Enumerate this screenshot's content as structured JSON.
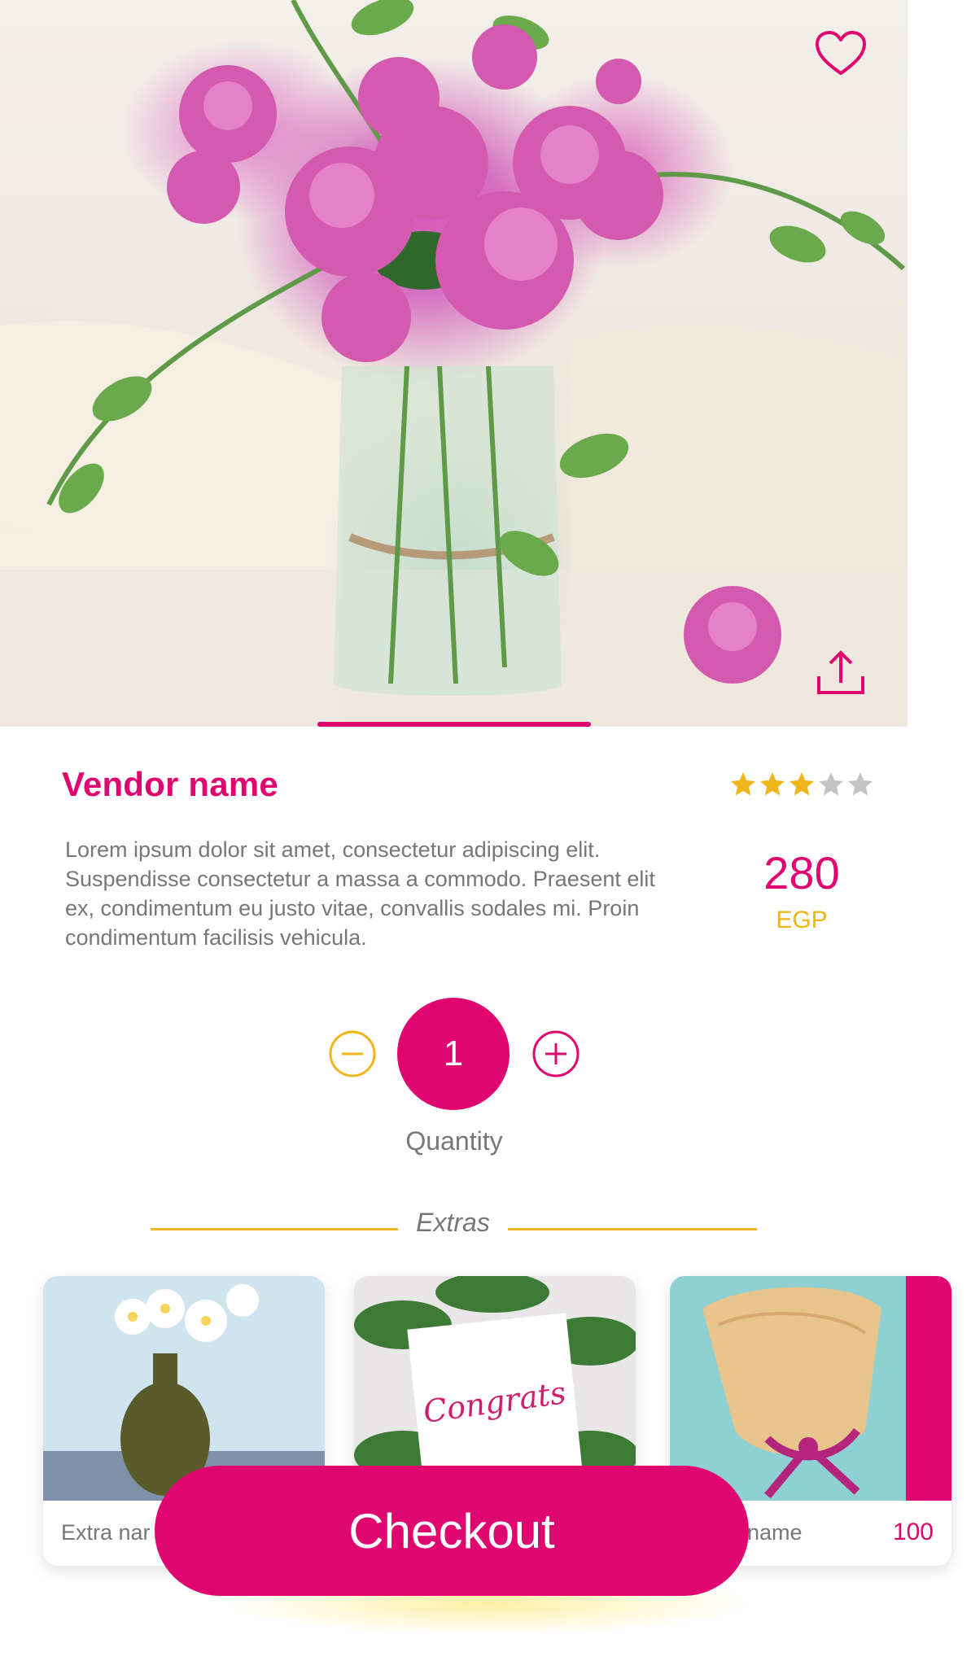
{
  "product": {
    "vendor_name": "Vendor name",
    "rating": 3,
    "rating_max": 5,
    "description": "Lorem ipsum dolor sit amet, consectetur adipiscing elit. Suspendisse consectetur a massa a commodo. Praesent elit ex, condimentum eu justo vitae, convallis sodales mi. Proin condimentum facilisis vehicula.",
    "price": "280",
    "currency": "EGP"
  },
  "quantity": {
    "value": "1",
    "label": "Quantity"
  },
  "extras": {
    "title": "Extras",
    "items": [
      {
        "name": "Extra nar",
        "price": ""
      },
      {
        "name": "",
        "price": ""
      },
      {
        "name": "name",
        "price": "100"
      }
    ],
    "card_text": "Congrats"
  },
  "checkout": {
    "label": "Checkout"
  },
  "colors": {
    "primary": "#e0066f",
    "accent": "#f1b51c",
    "text": "#777777"
  },
  "icons": [
    "heart-icon",
    "share-icon",
    "star-icon",
    "minus-icon",
    "plus-icon"
  ]
}
